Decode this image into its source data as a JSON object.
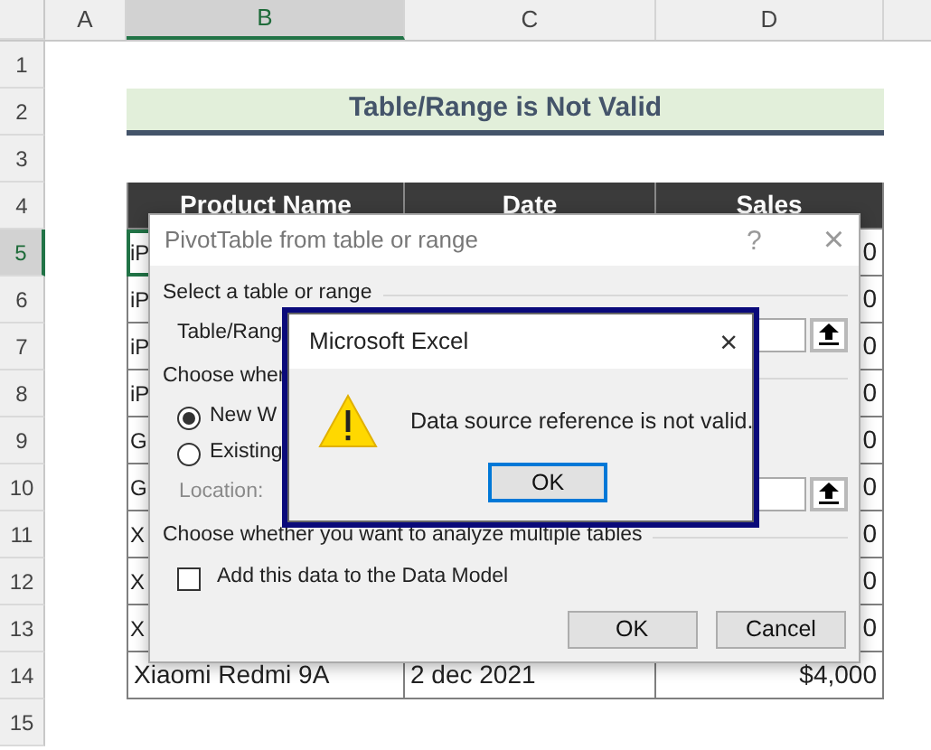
{
  "sheet": {
    "column_headers": [
      {
        "label": "A",
        "selected": false
      },
      {
        "label": "B",
        "selected": true
      },
      {
        "label": "C",
        "selected": false
      },
      {
        "label": "D",
        "selected": false
      }
    ],
    "row_headers": [
      {
        "label": "1",
        "selected": false
      },
      {
        "label": "2",
        "selected": false
      },
      {
        "label": "3",
        "selected": false
      },
      {
        "label": "4",
        "selected": false
      },
      {
        "label": "5",
        "selected": true
      },
      {
        "label": "6",
        "selected": false
      },
      {
        "label": "7",
        "selected": false
      },
      {
        "label": "8",
        "selected": false
      },
      {
        "label": "9",
        "selected": false
      },
      {
        "label": "10",
        "selected": false
      },
      {
        "label": "11",
        "selected": false
      },
      {
        "label": "12",
        "selected": false
      },
      {
        "label": "13",
        "selected": false
      },
      {
        "label": "14",
        "selected": false
      },
      {
        "label": "15",
        "selected": false
      }
    ],
    "title": "Table/Range is Not Valid",
    "table": {
      "columns": [
        "Product Name",
        "Date",
        "Sales"
      ],
      "rows": [
        {
          "product_name": "iP",
          "sales": "0",
          "selected": true
        },
        {
          "product_name": "iP",
          "sales": "0",
          "selected": false
        },
        {
          "product_name": "iP",
          "sales": "0",
          "selected": false
        },
        {
          "product_name": "iP",
          "sales": "0",
          "selected": false
        },
        {
          "product_name": "G",
          "sales": "0",
          "selected": false
        },
        {
          "product_name": "G",
          "sales": "0",
          "selected": false
        },
        {
          "product_name": "X",
          "sales": "0",
          "selected": false
        },
        {
          "product_name": "X",
          "sales": "0",
          "selected": false
        },
        {
          "product_name": "X",
          "sales": "0",
          "selected": false
        },
        {
          "product_name": "Xiaomi Redmi 9A",
          "date": "2 dec 2021",
          "sales": "$4,000",
          "selected": false
        }
      ]
    }
  },
  "pivot_dialog": {
    "title": "PivotTable from table or range",
    "help_button": "?",
    "close_button": "×",
    "source_heading": "Select a table or range",
    "table_range_label": "Table/Rang",
    "destination_heading": "Choose wher",
    "destination_options": [
      {
        "label": "New W",
        "selected": true
      },
      {
        "label": "Existing",
        "selected": false
      }
    ],
    "location_label": "Location:",
    "location_disabled": true,
    "analyze_heading": "Choose whether you want to analyze multiple tables",
    "data_model": {
      "label": "Add this data to the Data Model",
      "checked": false
    },
    "buttons": [
      "OK",
      "Cancel"
    ]
  },
  "message_box": {
    "title": "Microsoft Excel",
    "close_button": "×",
    "message": "Data source reference is not valid.",
    "buttons": [
      "OK"
    ]
  }
}
